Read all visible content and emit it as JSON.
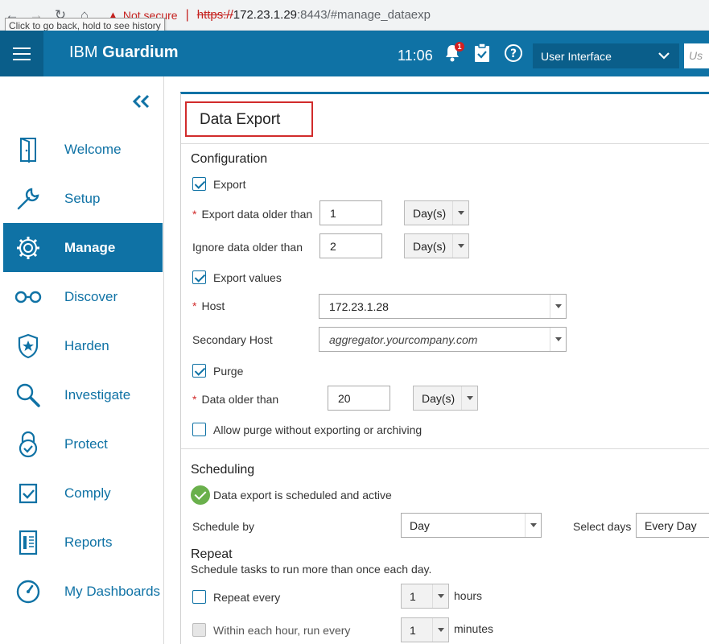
{
  "browser": {
    "tooltip": "Click to go back, hold to see history",
    "security_warning": "Not secure",
    "url_scheme": "https://",
    "url_host": "172.23.1.29",
    "url_rest": ":8443/#manage_dataexp"
  },
  "header": {
    "brand_light": "IBM ",
    "brand_bold": "Guardium",
    "time": "11:06",
    "notification_count": "1",
    "role_selector": "User Interface",
    "user_field_placeholder": "Us"
  },
  "sidebar": {
    "items": [
      {
        "label": "Welcome",
        "icon": "door-icon"
      },
      {
        "label": "Setup",
        "icon": "wrench-icon"
      },
      {
        "label": "Manage",
        "icon": "gear-icon",
        "active": true
      },
      {
        "label": "Discover",
        "icon": "glasses-icon"
      },
      {
        "label": "Harden",
        "icon": "shield-star-icon"
      },
      {
        "label": "Investigate",
        "icon": "magnifier-icon"
      },
      {
        "label": "Protect",
        "icon": "lock-check-icon"
      },
      {
        "label": "Comply",
        "icon": "clipboard-check-icon"
      },
      {
        "label": "Reports",
        "icon": "report-icon"
      },
      {
        "label": "My Dashboards",
        "icon": "dashboard-icon"
      }
    ]
  },
  "page": {
    "title": "Data Export",
    "configuration": {
      "heading": "Configuration",
      "export_label": "Export",
      "export_checked": true,
      "export_older_label": "Export data older than",
      "export_older_value": "1",
      "export_older_unit": "Day(s)",
      "ignore_older_label": "Ignore data older than",
      "ignore_older_value": "2",
      "ignore_older_unit": "Day(s)",
      "export_values_label": "Export values",
      "export_values_checked": true,
      "host_label": "Host",
      "host_value": "172.23.1.28",
      "secondary_host_label": "Secondary Host",
      "secondary_host_placeholder": "aggregator.yourcompany.com",
      "purge_label": "Purge",
      "purge_checked": true,
      "data_older_label": "Data older than",
      "data_older_value": "20",
      "data_older_unit": "Day(s)",
      "allow_purge_label": "Allow purge without exporting or archiving",
      "allow_purge_checked": false
    },
    "scheduling": {
      "heading": "Scheduling",
      "status": "Data export is scheduled and active",
      "schedule_by_label": "Schedule by",
      "schedule_by_value": "Day",
      "select_days_label": "Select days",
      "select_days_value": "Every Day"
    },
    "repeat": {
      "heading": "Repeat",
      "description": "Schedule tasks to run more than once each day.",
      "repeat_every_label": "Repeat every",
      "repeat_every_value": "1",
      "repeat_every_unit": "hours",
      "within_hour_label": "Within each hour, run every",
      "within_hour_value": "1",
      "within_hour_unit": "minutes"
    }
  },
  "colors": {
    "brand_blue": "#0f72a5",
    "brand_blue_dark": "#0a5e8a",
    "required_red": "#d12b2b",
    "ok_green": "#6ab04c"
  }
}
